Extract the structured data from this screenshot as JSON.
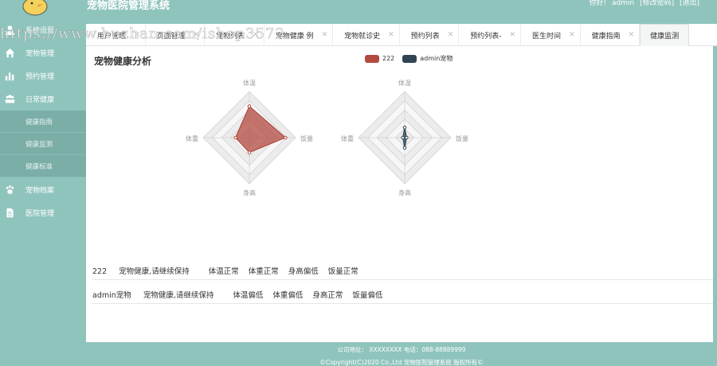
{
  "app": {
    "title": "宠物医院管理系统",
    "greeting": "你好!",
    "username": "admin",
    "change_password": "[修改密码]",
    "logout": "[退出]"
  },
  "sidebar": {
    "items": [
      {
        "label": "系统设置",
        "icon": "user-icon"
      },
      {
        "label": "宠物管理",
        "icon": "home-icon"
      },
      {
        "label": "预约管理",
        "icon": "bar-chart-icon"
      },
      {
        "label": "日常健康",
        "icon": "group-icon"
      },
      {
        "label": "宠物档案",
        "icon": "paw-icon"
      },
      {
        "label": "医院管理",
        "icon": "document-icon"
      }
    ],
    "sub_items": [
      "健康指南",
      "健康监测",
      "健康标准"
    ]
  },
  "tabs": [
    {
      "label": "用户管理"
    },
    {
      "label": "页面管理"
    },
    {
      "label": "宠物列表"
    },
    {
      "label": "宠物健康 例"
    },
    {
      "label": "宠物就诊史"
    },
    {
      "label": "预约列表"
    },
    {
      "label": "预约列表-"
    },
    {
      "label": "医生时间"
    },
    {
      "label": "健康指南"
    },
    {
      "label": "健康监测",
      "active": true
    }
  ],
  "chart_title": "宠物健康分析",
  "chart_data": {
    "type": "radar",
    "title": "宠物健康分析",
    "indicators": [
      "体温",
      "饭量",
      "身高",
      "体重"
    ],
    "series": [
      {
        "name": "222",
        "color": "#b24a40",
        "values": [
          0.68,
          0.78,
          0.32,
          0.3
        ]
      },
      {
        "name": "admin宠物",
        "color": "#2f4554",
        "values": [
          0.22,
          0.04,
          0.22,
          0.04
        ]
      }
    ]
  },
  "summaries": [
    {
      "pet": "222",
      "status": "宠物健康,请继续保持",
      "items": [
        "体温正常",
        "体重正常",
        "身高偏低",
        "饭量正常"
      ]
    },
    {
      "pet": "admin宠物",
      "status": "宠物健康,请继续保持",
      "items": [
        "体温偏低",
        "体重偏低",
        "身高正常",
        "饭量偏低"
      ]
    }
  ],
  "footer": {
    "address": "公司地址： XXXXXXXX 电话：088-88889999",
    "copyright": "©Copyright(C)2020 Co.,Ltd 宠物医院管理系统 版权所有©"
  },
  "watermark": "https://www.huzhan.com/ishop3572"
}
